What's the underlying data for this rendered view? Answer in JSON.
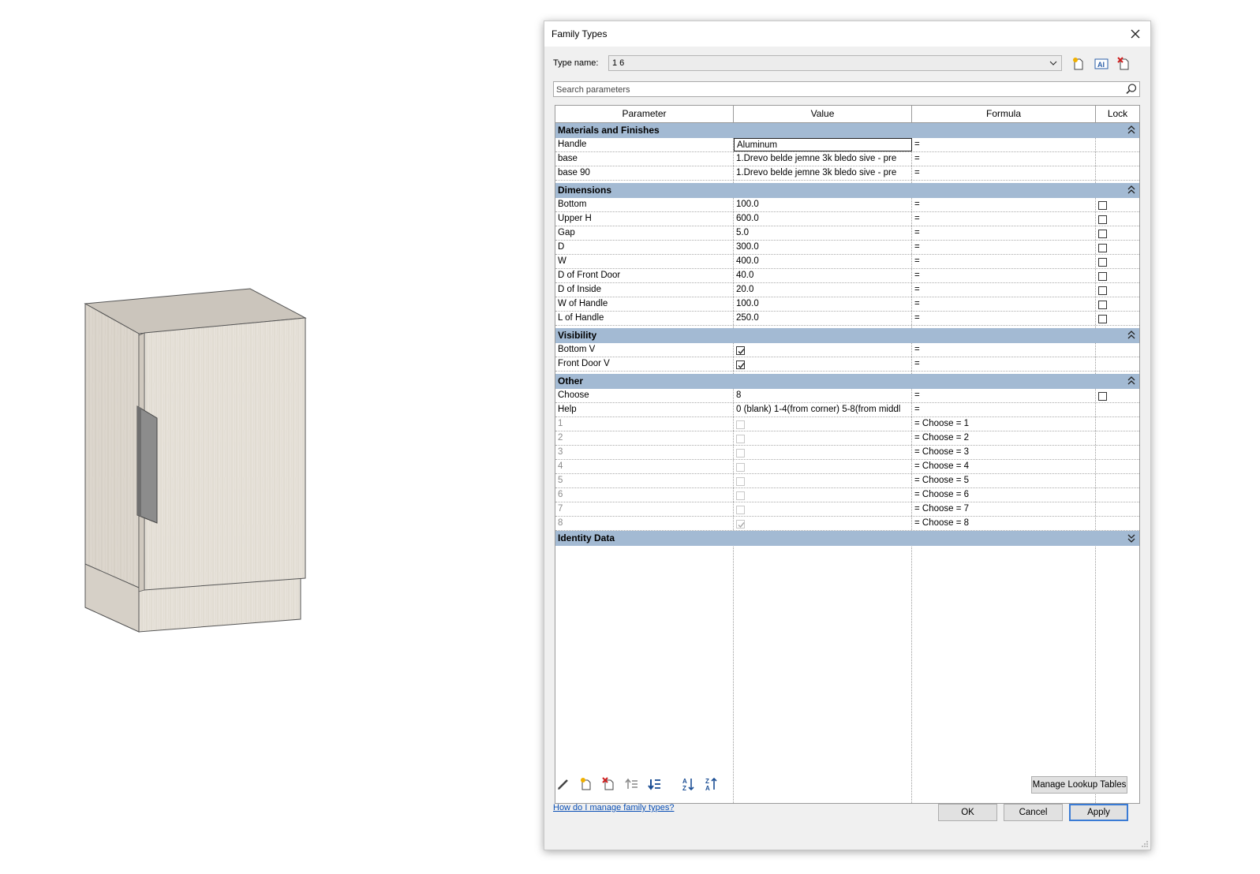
{
  "dialog": {
    "title": "Family Types",
    "type_name_label": "Type name:",
    "type_name_value": "1 6",
    "search_placeholder": "Search parameters",
    "columns": {
      "parameter": "Parameter",
      "value": "Value",
      "formula": "Formula",
      "lock": "Lock"
    },
    "groups": {
      "materials": "Materials and Finishes",
      "dimensions": "Dimensions",
      "visibility": "Visibility",
      "other": "Other",
      "identity": "Identity Data"
    },
    "materials_rows": [
      {
        "parameter": "Handle",
        "value": "Aluminum",
        "formula": "="
      },
      {
        "parameter": "base",
        "value": "1.Drevo belde jemne 3k bledo sive - pre",
        "formula": "="
      },
      {
        "parameter": "base 90",
        "value": "1.Drevo belde jemne 3k bledo sive - pre",
        "formula": "="
      }
    ],
    "dimension_rows": [
      {
        "parameter": "Bottom",
        "value": "100.0",
        "formula": "="
      },
      {
        "parameter": "Upper H",
        "value": "600.0",
        "formula": "="
      },
      {
        "parameter": "Gap",
        "value": "5.0",
        "formula": "="
      },
      {
        "parameter": "D",
        "value": "300.0",
        "formula": "="
      },
      {
        "parameter": "W",
        "value": "400.0",
        "formula": "="
      },
      {
        "parameter": "D of Front Door",
        "value": "40.0",
        "formula": "="
      },
      {
        "parameter": "D of Inside",
        "value": "20.0",
        "formula": "="
      },
      {
        "parameter": "W of Handle",
        "value": "100.0",
        "formula": "="
      },
      {
        "parameter": "L of Handle",
        "value": "250.0",
        "formula": "="
      }
    ],
    "visibility_rows": [
      {
        "parameter": "Bottom V",
        "checked": true,
        "formula": "="
      },
      {
        "parameter": "Front Door V",
        "checked": true,
        "formula": "="
      }
    ],
    "other_rows": [
      {
        "parameter": "Choose",
        "value": "8",
        "formula": "="
      },
      {
        "parameter": "Help",
        "value": "0 (blank) 1-4(from corner) 5-8(from middl",
        "formula": "="
      }
    ],
    "choose_rows": [
      {
        "parameter": "1",
        "checked": false,
        "formula": "= Choose = 1"
      },
      {
        "parameter": "2",
        "checked": false,
        "formula": "= Choose = 2"
      },
      {
        "parameter": "3",
        "checked": false,
        "formula": "= Choose = 3"
      },
      {
        "parameter": "4",
        "checked": false,
        "formula": "= Choose = 4"
      },
      {
        "parameter": "5",
        "checked": false,
        "formula": "= Choose = 5"
      },
      {
        "parameter": "6",
        "checked": false,
        "formula": "= Choose = 6"
      },
      {
        "parameter": "7",
        "checked": false,
        "formula": "= Choose = 7"
      },
      {
        "parameter": "8",
        "checked": true,
        "formula": "= Choose = 8"
      }
    ],
    "manage_lookup_label": "Manage Lookup Tables",
    "help_link": "How do I manage family types?",
    "ok_label": "OK",
    "cancel_label": "Cancel",
    "apply_label": "Apply"
  },
  "colors": {
    "group_header": "#a3bad3",
    "apply_border": "#3a7bd5",
    "link": "#0a4fb5"
  }
}
